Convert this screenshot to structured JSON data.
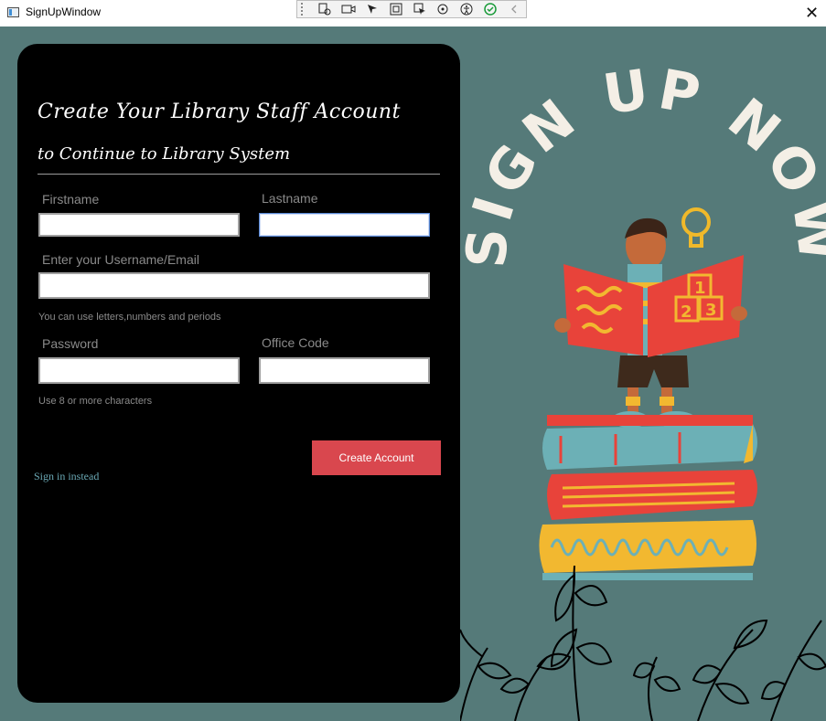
{
  "window": {
    "title": "SignUpWindow",
    "close_glyph": "✕"
  },
  "devtools": {
    "icons": [
      "live-tree-icon",
      "record-icon",
      "select-element-icon",
      "display-layout-adorners-icon",
      "track-focus-icon",
      "binding-failures-icon",
      "accessibility-icon",
      "check-icon",
      "collapse-icon"
    ]
  },
  "form": {
    "heading_line1": "Create Your Library Staff Account",
    "heading_line2": "to Continue to Library System",
    "firstname_label": "Firstname",
    "firstname_value": "",
    "lastname_label": "Lastname",
    "lastname_value": "",
    "username_label": "Enter your Username/Email",
    "username_value": "",
    "username_hint": "You can use letters,numbers and periods",
    "password_label": "Password",
    "password_value": "",
    "office_code_label": "Office Code",
    "office_code_value": "",
    "password_hint": "Use 8 or more characters",
    "signin_link": "Sign in instead",
    "create_button": "Create Account"
  },
  "banner": {
    "headline": "SIGN UP NOW",
    "book_numbers": [
      "1",
      "2",
      "3"
    ]
  },
  "colors": {
    "background": "#557a79",
    "card": "#000000",
    "button": "#d9474e",
    "link": "#6aa8b4",
    "headline": "#f4efe6"
  }
}
